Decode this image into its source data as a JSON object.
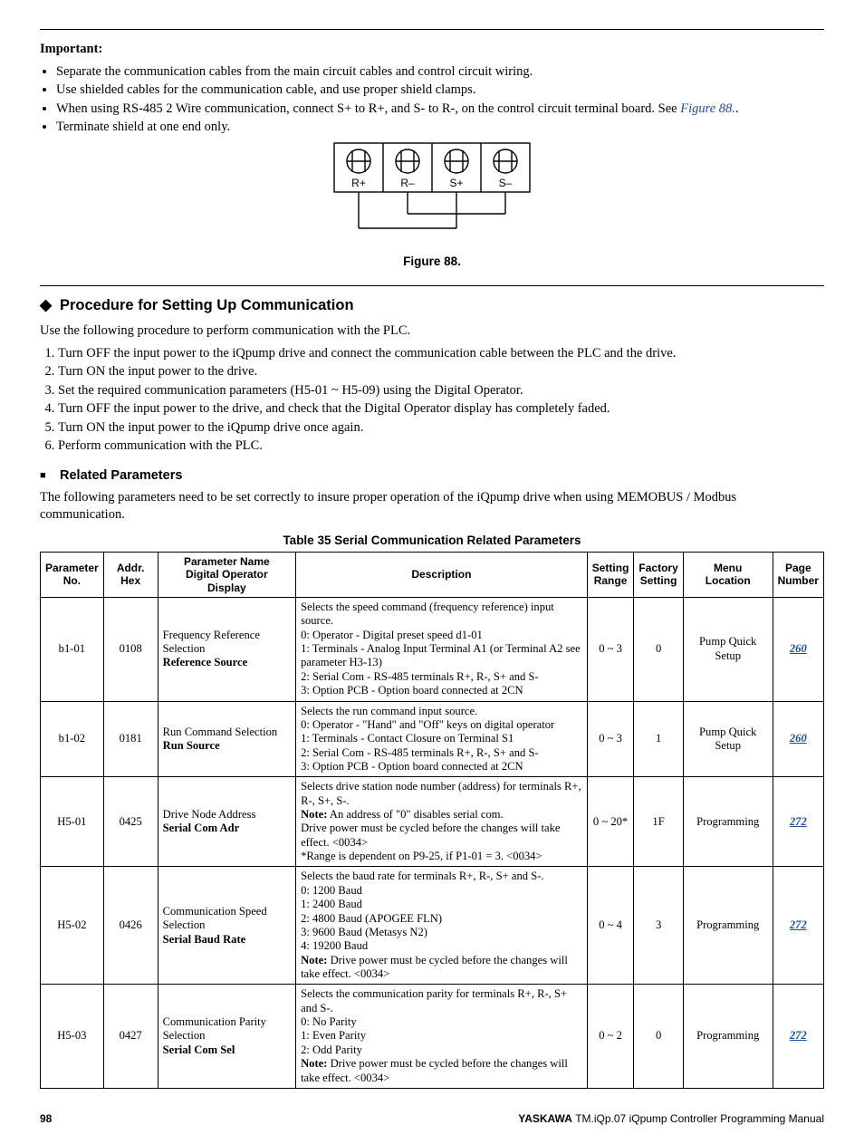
{
  "important": {
    "heading": "Important:",
    "bullets": [
      {
        "text": "Separate the communication cables from the main circuit cables and control circuit wiring."
      },
      {
        "text": "Use shielded cables for the communication cable, and use proper shield clamps."
      },
      {
        "text_html": "When using RS-485 2 Wire communication, connect S+ to R+, and S- to R-, on the control circuit terminal board. See <a class='link' href='#' data-interactable='true' data-name='figure-88-link'>Figure 88.</a>."
      },
      {
        "text": "Terminate shield at one end only."
      }
    ]
  },
  "figure": {
    "caption": "Figure 88.",
    "terminals": [
      "R+",
      "R–",
      "S+",
      "S–"
    ]
  },
  "section": {
    "title": "Procedure for Setting Up Communication",
    "intro": "Use the following procedure to perform communication with the PLC.",
    "steps": [
      "Turn OFF the input power to the iQpump drive and connect the communication cable between the PLC and the drive.",
      "Turn ON the input power to the drive.",
      "Set the required communication parameters (H5-01 ~ H5-09) using the Digital Operator.",
      "Turn OFF the input power to the drive, and check that the Digital Operator display has completely faded.",
      "Turn ON the input power to the iQpump drive once again.",
      "Perform communication with the PLC."
    ]
  },
  "related": {
    "title": "Related Parameters",
    "intro": "The following parameters need to be set correctly to insure proper operation of the iQpump drive when using MEMOBUS / Modbus communication."
  },
  "table": {
    "caption": "Table 35  Serial Communication Related Parameters",
    "headers": [
      "Parameter No.",
      "Addr. Hex",
      "Parameter Name Digital Operator Display",
      "Description",
      "Setting Range",
      "Factory Setting",
      "Menu Location",
      "Page Number"
    ],
    "header_lines": {
      "0": [
        "Parameter",
        "No."
      ],
      "1": [
        "Addr. Hex"
      ],
      "2": [
        "Parameter Name",
        "Digital Operator",
        "Display"
      ],
      "3": [
        "Description"
      ],
      "4": [
        "Setting",
        "Range"
      ],
      "5": [
        "Factory",
        "Setting"
      ],
      "6": [
        "Menu",
        "Location"
      ],
      "7": [
        "Page",
        "Number"
      ]
    },
    "rows": [
      {
        "no": "b1-01",
        "hex": "0108",
        "name": "Frequency Reference Selection",
        "disp": "Reference Source",
        "desc_html": "Selects the speed command (frequency reference) input source.<br>0: Operator - Digital preset speed d1-01<br>1: Terminals - Analog Input Terminal A1 (or Terminal A2 see parameter H3-13)<br>2: Serial Com - RS-485 terminals R+, R-, S+ and S-<br>3: Option PCB - Option board connected at 2CN",
        "range": "0 ~ 3",
        "factory": "0",
        "menu": "Pump Quick Setup",
        "page": "260"
      },
      {
        "no": "b1-02",
        "hex": "0181",
        "name": "Run Command Selection",
        "disp": "Run Source",
        "desc_html": "Selects the run command input source.<br>0: Operator - \"Hand\" and \"Off\" keys on digital operator<br>1: Terminals - Contact Closure on Terminal S1<br>2: Serial Com - RS-485 terminals R+, R-, S+ and S-<br>3: Option PCB - Option board connected at 2CN",
        "range": "0 ~ 3",
        "factory": "1",
        "menu": "Pump Quick Setup",
        "page": "260"
      },
      {
        "no": "H5-01",
        "hex": "0425",
        "name": "Drive Node Address",
        "disp": "Serial Com Adr",
        "desc_html": "Selects drive station node number (address) for terminals R+, R-, S+, S-.<br><b>Note:</b> An address of \"0\" disables serial com.<br>Drive power must be cycled before the changes will take effect. &lt;0034&gt;<br>*Range is dependent on P9-25, if P1-01 = 3. &lt;0034&gt;",
        "range": "0 ~ 20*",
        "factory": "1F",
        "menu": "Programming",
        "page": "272"
      },
      {
        "no": "H5-02",
        "hex": "0426",
        "name": "Communication Speed Selection",
        "disp": "Serial Baud Rate",
        "desc_html": "Selects the baud rate for terminals R+, R-, S+ and S-.<br>0: 1200 Baud<br>1: 2400 Baud<br>2: 4800 Baud (APOGEE FLN)<br>3: 9600 Baud (Metasys N2)<br>4: 19200 Baud<br><b>Note:</b> Drive power must be cycled before the changes will take effect. &lt;0034&gt;",
        "range": "0 ~ 4",
        "factory": "3",
        "menu": "Programming",
        "page": "272"
      },
      {
        "no": "H5-03",
        "hex": "0427",
        "name": "Communication Parity Selection",
        "disp": "Serial Com Sel",
        "desc_html": "Selects the communication parity for terminals R+, R-, S+ and S-.<br>0: No Parity<br>1: Even Parity<br>2: Odd Parity<br><b>Note:</b> Drive power must be cycled before the changes will take effect. &lt;0034&gt;",
        "range": "0 ~ 2",
        "factory": "0",
        "menu": "Programming",
        "page": "272"
      }
    ]
  },
  "footer": {
    "page": "98",
    "brand": "YASKAWA",
    "doc": "TM.iQp.07 iQpump Controller Programming Manual"
  }
}
